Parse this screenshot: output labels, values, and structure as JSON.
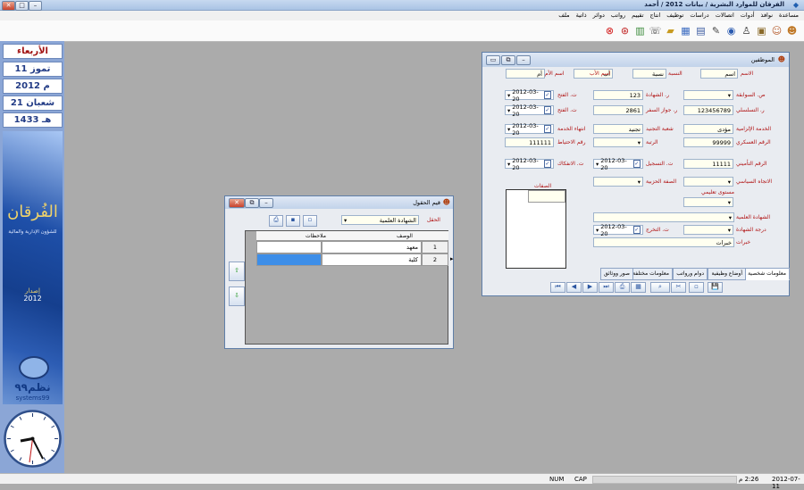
{
  "window": {
    "title": "الفرقان للموارد البشرية / بيانات 2012 / أحمد"
  },
  "menu": [
    "ملف",
    "ذاتية",
    "دوائر",
    "رواتب",
    "تقييم",
    "انتاج",
    "توظيف",
    "دراسات",
    "اتصالات",
    "أدوات",
    "نوافذ",
    "مساعدة"
  ],
  "toolbar": [
    "user-icon",
    "users-icon",
    "id-card-icon",
    "person-icon",
    "globe-icon",
    "pen-icon",
    "book-icon",
    "calculator-icon",
    "briefcase-icon",
    "phone-icon",
    "document-icon",
    "search-icon",
    "close-icon"
  ],
  "sidebar": {
    "day": "الأربعاء",
    "month_date": "11 تموز",
    "year": "2012 م",
    "hijri_date": "21 شعبان",
    "hijri_year": "1433 هـ",
    "brand": "الفُرقان",
    "brand_sub": "للشؤون الإدارية والمالية",
    "edition": "إصدار",
    "edition_year": "2012",
    "company": "نظم٩٩",
    "company_latin": "systems99"
  },
  "status": {
    "date": "2012-07-11",
    "time": "2:26 م",
    "cap": "CAP",
    "num": "NUM"
  },
  "employee_form": {
    "title": "الموظفين",
    "name_labels": {
      "first": "الاسم",
      "father": "اسم الأب",
      "grand": "اسم الأم",
      "surname": "النسبة",
      "person": "أم"
    },
    "name_placeholders": {
      "first": "اسم",
      "father": "أب",
      "surname": "نسبة"
    },
    "fields": {
      "level_label": "ص. السوابقة",
      "cert_no_label": "ر. الشهادة",
      "cert_no": "123",
      "birth_date_label": "ت. الفتح",
      "birth_date": "2012-03-20",
      "serial_label": "ر. التسلسلي",
      "serial": "123456789",
      "passport_label": "ر. جواز السفر",
      "passport": "2861",
      "open_date_label": "ت. الفتح",
      "open_date": "2012-03-20",
      "service_label": "الخدمة الإلزامية",
      "service": "مؤدى",
      "service_branch_label": "شعبة التجنيد",
      "service_branch": "تجنيد",
      "end_service_label": "انتهاء الخدمة",
      "end_service": "2012-03-20",
      "military_no_label": "الرقم العسكري",
      "military_no": "99999",
      "rank_label": "الرتبة",
      "reserve_no_label": "رقم الاحتياط",
      "reserve_no": "111111",
      "insurance_no_label": "الرقم التأميني",
      "insurance_no": "11111",
      "reg_date_label": "ت. التسجيل",
      "reg_date": "2012-03-20",
      "disconnect_date_label": "ت. الانفكاك",
      "disconnect_date": "2012-03-20",
      "politics_label": "الاتجاه السياسي",
      "party_label": "الصفة الحزبية",
      "traits_label": "الصفات",
      "education_label": "مستوى تعليمي",
      "cert_label": "الشهادة العلمية",
      "grade_label": "درجة الشهادة",
      "grad_date_label": "ت. التخرج",
      "grad_date": "2012-03-20",
      "experience_label": "خبرات",
      "experience": "خبرات"
    },
    "tabs": [
      "معلومات شخصية",
      "أوضاع وظيفية",
      "دوام ورواتب",
      "معلومات مختلفة",
      "صور ووثائق"
    ],
    "nav": [
      "first",
      "prev",
      "next",
      "last",
      "print",
      "grid",
      "search",
      "delete",
      "new",
      "save"
    ]
  },
  "lookup_form": {
    "title": "قيم الحقول",
    "field_label": "الحقل",
    "field_value": "الشهادة العلمية",
    "columns": [
      "الوصف",
      "ملاحظات"
    ],
    "rows": [
      {
        "no": "1",
        "desc": "معهد",
        "notes": ""
      },
      {
        "no": "2",
        "desc": "كلية",
        "notes": ""
      }
    ]
  }
}
